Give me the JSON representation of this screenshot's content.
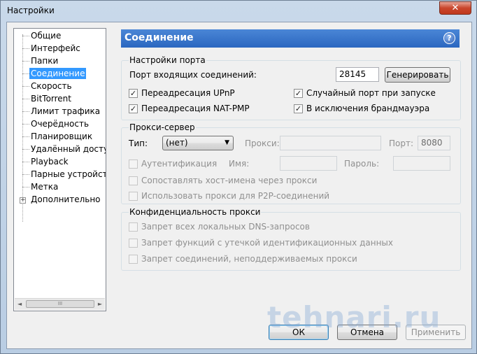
{
  "window": {
    "title": "Настройки",
    "close_glyph": "✕"
  },
  "sidebar": {
    "items": [
      {
        "label": "Общие"
      },
      {
        "label": "Интерфейс"
      },
      {
        "label": "Папки"
      },
      {
        "label": "Соединение",
        "selected": true
      },
      {
        "label": "Скорость"
      },
      {
        "label": "BitTorrent"
      },
      {
        "label": "Лимит трафика"
      },
      {
        "label": "Очерёдность"
      },
      {
        "label": "Планировщик"
      },
      {
        "label": "Удалённый доступ"
      },
      {
        "label": "Playback"
      },
      {
        "label": "Парные устройства"
      },
      {
        "label": "Метка"
      },
      {
        "label": "Дополнительно",
        "expandable": true
      }
    ],
    "expander_glyph": "+",
    "scroll_thumb_glyph": "III",
    "scroll_left_glyph": "◄",
    "scroll_right_glyph": "►"
  },
  "header": {
    "title": "Соединение",
    "help_glyph": "?"
  },
  "port_settings": {
    "group_title": "Настройки порта",
    "incoming_port_label": "Порт входящих соединений:",
    "incoming_port_value": "28145",
    "generate_button": "Генерировать",
    "upnp_label": "Переадресация UPnP",
    "upnp_checked": true,
    "natpmp_label": "Переадресация NAT-PMP",
    "natpmp_checked": true,
    "random_port_label": "Случайный порт при запуске",
    "random_port_checked": true,
    "firewall_label": "В исключения брандмауэра",
    "firewall_checked": true
  },
  "proxy": {
    "group_title": "Прокси-сервер",
    "type_label": "Тип:",
    "type_value": "(нет)",
    "proxy_label": "Прокси:",
    "proxy_value": "",
    "port_label": "Порт:",
    "port_value": "8080",
    "auth_label": "Аутентификация",
    "auth_checked": false,
    "username_label": "Имя:",
    "username_value": "",
    "password_label": "Пароль:",
    "password_value": "",
    "resolve_hostnames_label": "Сопоставлять хост-имена через прокси",
    "resolve_hostnames_checked": false,
    "p2p_label": "Использовать прокси для P2P-соединений",
    "p2p_checked": false
  },
  "privacy": {
    "group_title": "Конфиденциальность прокси",
    "dns_label": "Запрет всех локальных DNS-запросов",
    "leak_label": "Запрет функций с утечкой идентификационных данных",
    "unsupported_label": "Запрет соединений, неподдерживаемых прокси"
  },
  "footer": {
    "ok_button": "ОК",
    "cancel_button": "Отмена",
    "apply_button": "Применить"
  },
  "watermark": "tehnari.ru",
  "checkmark_glyph": "✓",
  "dropdown_arrow_glyph": "▼"
}
